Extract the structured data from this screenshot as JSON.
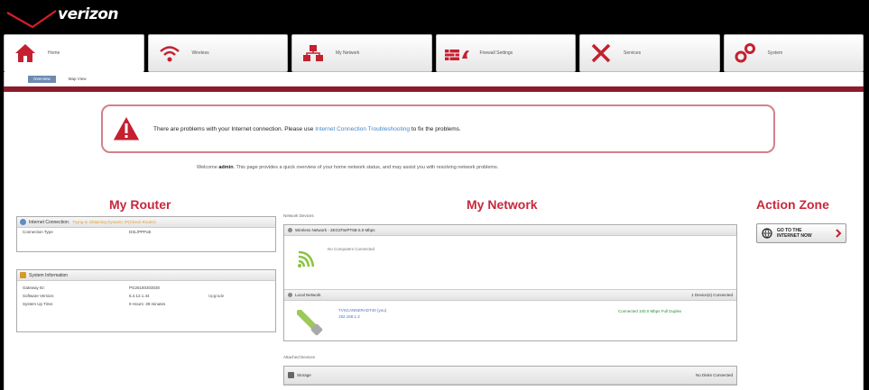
{
  "brand": {
    "logo_text": "verizon"
  },
  "nav": {
    "tabs": [
      {
        "label": "Home",
        "icon": "home-icon",
        "active": true
      },
      {
        "label": "Wireless",
        "icon": "wifi-icon",
        "active": false
      },
      {
        "label": "My Network",
        "icon": "network-icon",
        "active": false
      },
      {
        "label": "Firewall Settings",
        "icon": "firewall-icon",
        "active": false
      },
      {
        "label": "Services",
        "icon": "tools-icon",
        "active": false
      },
      {
        "label": "System",
        "icon": "system-icon",
        "active": false
      }
    ],
    "subtabs": [
      {
        "label": "Overview",
        "active": true
      },
      {
        "label": "Map View",
        "active": false
      }
    ]
  },
  "alert": {
    "text_before": "There are problems with your Internet connection. Please use ",
    "link_text": "Internet Connection Troubleshooting",
    "text_after": " to fix the problems."
  },
  "welcome": {
    "prefix": "Welcome ",
    "user": "admin",
    "text": ". This page provides a quick overview of your home network status, and may assist you with resolving network problems."
  },
  "columns": {
    "router_title": "My Router",
    "network_title": "My Network",
    "action_title": "Action Zone"
  },
  "router": {
    "internet": {
      "title": "Internet Connection:",
      "status": "Trying to Obtaining Dynamic IP(Check Router)",
      "rows": [
        {
          "k": "Connection Type",
          "v": "DSL/PPPoE"
        }
      ]
    },
    "system": {
      "title": "System Information",
      "rows": [
        {
          "k": "Gateway ID:",
          "v": "PG26180303030",
          "a": ""
        },
        {
          "k": "Software Version:",
          "v": "5.4.12.1.44",
          "a": "Upgrade"
        },
        {
          "k": "System Up Time:",
          "v": "9 Hours: 39 minutes",
          "a": ""
        }
      ]
    }
  },
  "network": {
    "devices_label": "Network Devices",
    "wireless": {
      "title": "Wireless Network - 2EG3TwIPT6B 5.0 Mbps",
      "note": "No Computers Connected"
    },
    "local": {
      "title": "Local Network",
      "count": "1 Device(s) Connected",
      "device_name": "TVSCANNERADT40 (you)",
      "device_ip": "192.168.1.2",
      "device_status": "Connected 100.0 Mbps Full Duplex"
    },
    "attached_label": "Attached Devices",
    "storage": {
      "title": "Storage",
      "status": "No Disks Connected"
    }
  },
  "action_zone": {
    "button_line1": "GO TO THE",
    "button_line2": "INTERNET NOW"
  },
  "colors": {
    "accent": "#c8283c",
    "alert_border": "#d48089",
    "link": "#4a86c9",
    "subnav_bar": "#8a1c2b"
  }
}
